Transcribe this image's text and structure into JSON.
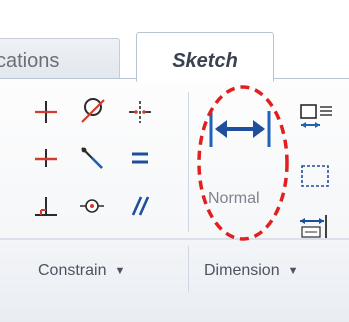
{
  "tabs": {
    "applications_label": "cations",
    "sketch_label": "Sketch"
  },
  "groups": {
    "constrain_label": "Constrain",
    "dimension_label": "Dimension"
  },
  "tools": {
    "normal_label": "Normal"
  },
  "icons": {
    "constrain": [
      "perpendicular-cross-icon",
      "tangent-icon",
      "symmetric-icon",
      "horizontal-icon",
      "coincident-line-icon",
      "equal-icon",
      "perpendicular-icon",
      "point-on-entity-icon",
      "parallel-icon"
    ],
    "dimension_large": "normal-dimension-icon",
    "dimension_small": [
      "baseline-dimension-icon",
      "reference-dimension-icon",
      "ordinate-dimension-icon"
    ]
  },
  "colors": {
    "accent_blue": "#1f62b8",
    "annotation_red": "#e02020",
    "ribbon_border": "#b9c4d2"
  }
}
